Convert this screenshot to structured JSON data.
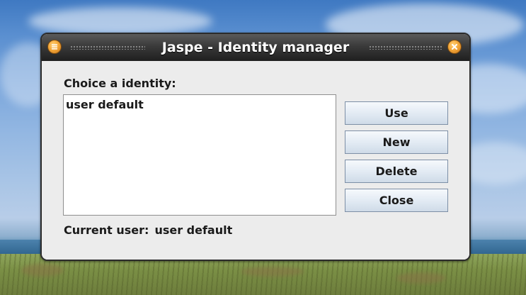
{
  "window": {
    "title": "Jaspe - Identity manager"
  },
  "dialog": {
    "choice_label": "Choice a identity:",
    "identities": [
      "user default"
    ],
    "buttons": {
      "use": "Use",
      "new": "New",
      "delete": "Delete",
      "close": "Close"
    },
    "status": {
      "label": "Current user:",
      "value": "user default"
    }
  },
  "icons": {
    "titlebar_left": "menu-icon",
    "titlebar_right": "close-icon"
  },
  "colors": {
    "titlebar": "#2e2e2e",
    "titlebar_button": "#f4a83a",
    "window_bg": "#ececec",
    "button_border": "#7d8fa6"
  }
}
